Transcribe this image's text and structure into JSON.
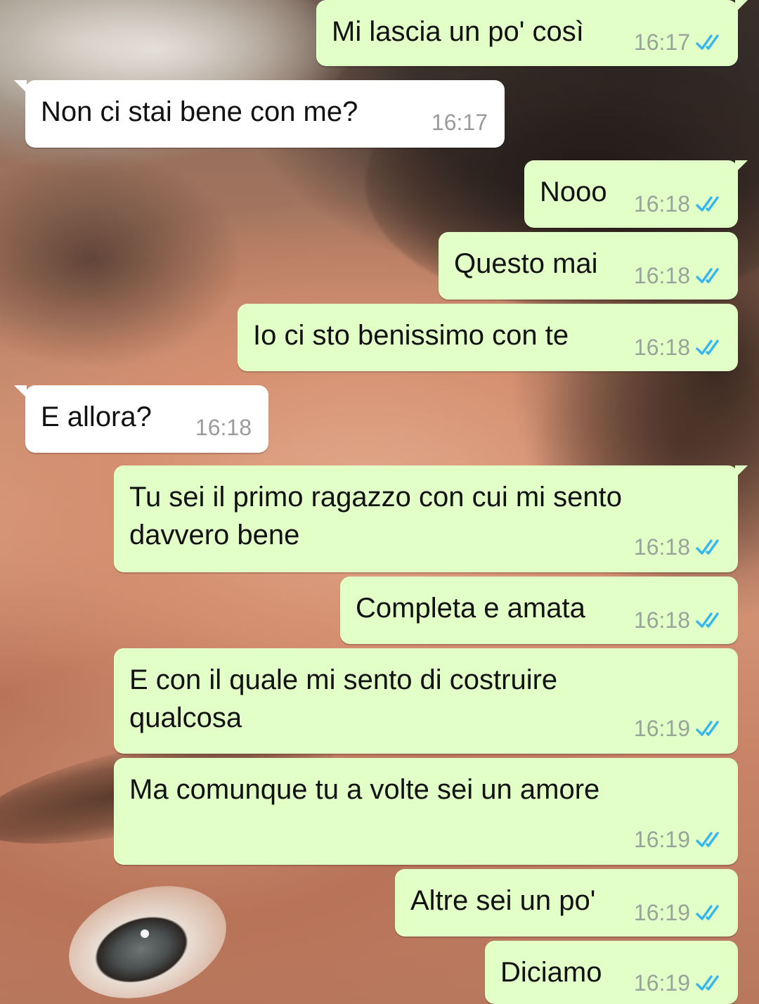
{
  "colors": {
    "outgoing_bubble": "#e1ffc7",
    "incoming_bubble": "#ffffff",
    "read_ticks": "#34b7f1",
    "timestamp": "#9aa39a"
  },
  "messages": [
    {
      "direction": "out",
      "text": "Mi lascia un po' così",
      "time": "16:17",
      "status": "read-double-check-icon"
    },
    {
      "direction": "in",
      "text": "Non ci stai bene con me?",
      "time": "16:17"
    },
    {
      "direction": "out",
      "text": "Nooo",
      "time": "16:18",
      "status": "read-double-check-icon"
    },
    {
      "direction": "out",
      "text": "Questo mai",
      "time": "16:18",
      "status": "read-double-check-icon"
    },
    {
      "direction": "out",
      "text": "Io ci sto benissimo con te",
      "time": "16:18",
      "status": "read-double-check-icon"
    },
    {
      "direction": "in",
      "text": "E allora?",
      "time": "16:18"
    },
    {
      "direction": "out",
      "text": "Tu sei il primo ragazzo con cui mi sento\ndavvero bene",
      "time": "16:18",
      "status": "read-double-check-icon"
    },
    {
      "direction": "out",
      "text": "Completa e amata",
      "time": "16:18",
      "status": "read-double-check-icon"
    },
    {
      "direction": "out",
      "text": "E con il quale mi sento di costruire\nqualcosa",
      "time": "16:19",
      "status": "read-double-check-icon"
    },
    {
      "direction": "out",
      "text": "Ma comunque tu a volte sei un amore",
      "time": "16:19",
      "status": "read-double-check-icon"
    },
    {
      "direction": "out",
      "text": "Altre sei un po'",
      "time": "16:19",
      "status": "read-double-check-icon"
    },
    {
      "direction": "out",
      "text": "Diciamo",
      "time": "16:19",
      "status": "read-double-check-icon"
    }
  ]
}
